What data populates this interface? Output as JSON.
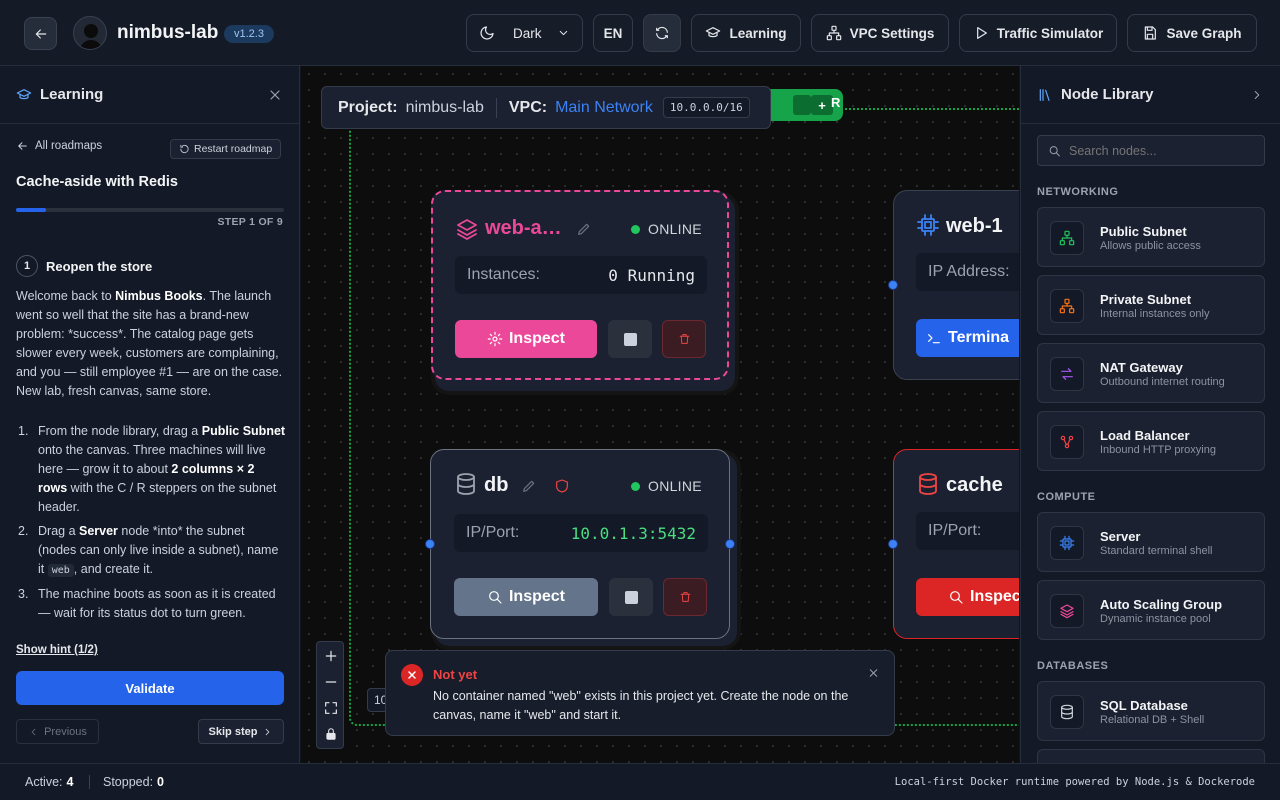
{
  "header": {
    "app_title": "nimbus-lab",
    "version": "v1.2.3",
    "theme_select": "Dark",
    "language": "EN",
    "buttons": {
      "learning": "Learning",
      "vpc_settings": "VPC Settings",
      "traffic_simulator": "Traffic Simulator",
      "save_graph": "Save Graph"
    }
  },
  "learning_panel": {
    "title": "Learning",
    "all_roadmaps": "All roadmaps",
    "restart": "Restart roadmap",
    "roadmap_title": "Cache-aside with Redis",
    "step_label": "STEP 1 OF 9",
    "progress": 0.111,
    "step_number": "1",
    "step_title": "Reopen the store",
    "intro": {
      "p1": "Welcome back to ",
      "b1": "Nimbus Books",
      "p2": ". The launch went so well that the site has a brand-new problem: *success*. The catalog page gets slower every week, customers are complaining, and you — still employee #1 — are on the case. New lab, fresh canvas, same store."
    },
    "steps": [
      {
        "num": "1.",
        "t1": "From the node library, drag a ",
        "b1": "Public Subnet",
        "t2": " onto the canvas. Three machines will live here — grow it to about ",
        "b2": "2 columns × 2 rows",
        "t3": " with the C / R steppers on the subnet header."
      },
      {
        "num": "2.",
        "t1": "Drag a ",
        "b1": "Server",
        "t2": " node *into* the subnet (nodes can only live inside a subnet), name it ",
        "code": "web",
        "t3": ", and create it."
      },
      {
        "num": "3.",
        "t1": "The machine boots as soon as it is created — wait for its status dot to turn green."
      }
    ],
    "hint": "Show hint (1/2)",
    "validate": "Validate",
    "previous": "Previous",
    "skip": "Skip step"
  },
  "canvas": {
    "project_label": "Project:",
    "project_name": "nimbus-lab",
    "vpc_label": "VPC:",
    "vpc_name": "Main Network",
    "cidr": "10.0.0.0/16",
    "subnet_plus": "+",
    "subnet_r": "R",
    "zoom_badge": "10",
    "nodes": {
      "web_asg": {
        "title": "web-a…",
        "status": "ONLINE",
        "field_label": "Instances:",
        "field_value": "0 Running",
        "inspect": "Inspect"
      },
      "web1": {
        "title": "web-1",
        "field_label": "IP Address:",
        "action": "Termina"
      },
      "db": {
        "title": "db",
        "status": "ONLINE",
        "field_label": "IP/Port:",
        "field_value": "10.0.1.3:5432",
        "inspect": "Inspect"
      },
      "cache": {
        "title": "cache",
        "field_label": "IP/Port:",
        "inspect": "Inspec"
      }
    },
    "toast": {
      "title": "Not yet",
      "message": "No container named \"web\" exists in this project yet. Create the node on the canvas, name it \"web\" and start it."
    }
  },
  "node_library": {
    "title": "Node Library",
    "search_placeholder": "Search nodes...",
    "categories": {
      "networking": "NETWORKING",
      "compute": "COMPUTE",
      "databases": "DATABASES"
    },
    "items": [
      {
        "name": "Public Subnet",
        "desc": "Allows public access",
        "icon": "network-icon",
        "color": "#22c55e"
      },
      {
        "name": "Private Subnet",
        "desc": "Internal instances only",
        "icon": "network-icon",
        "color": "#f97316"
      },
      {
        "name": "NAT Gateway",
        "desc": "Outbound internet routing",
        "icon": "arrows-icon",
        "color": "#a855f7"
      },
      {
        "name": "Load Balancer",
        "desc": "Inbound HTTP proxying",
        "icon": "share-icon",
        "color": "#ef4444"
      },
      {
        "name": "Server",
        "desc": "Standard terminal shell",
        "icon": "cpu-icon",
        "color": "#3b82f6"
      },
      {
        "name": "Auto Scaling Group",
        "desc": "Dynamic instance pool",
        "icon": "layers-icon",
        "color": "#ec4899"
      },
      {
        "name": "SQL Database",
        "desc": "Relational DB + Shell",
        "icon": "database-icon",
        "color": "#d1d5db"
      }
    ]
  },
  "status_bar": {
    "active_label": "Active:",
    "active_count": "4",
    "stopped_label": "Stopped:",
    "stopped_count": "0",
    "footer": "Local-first Docker runtime powered by Node.js & Dockerode"
  },
  "colors": {
    "accent": "#2563eb",
    "pink": "#ec4899",
    "red": "#dc2626",
    "green": "#22c55e"
  }
}
